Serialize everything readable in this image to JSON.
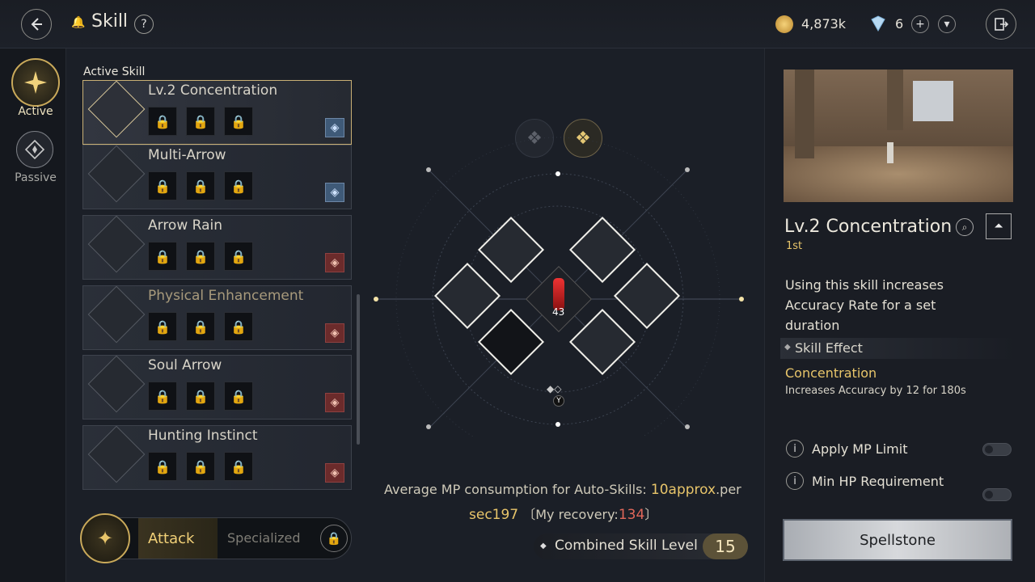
{
  "header": {
    "title": "Skill",
    "help_label": "?",
    "gold_amount": "4,873k",
    "gem_amount": "6",
    "plus_label": "+",
    "chevron_label": "▾"
  },
  "nav": {
    "active_label": "Active",
    "passive_label": "Passive"
  },
  "skill_list": {
    "heading": "Active Skill",
    "skills": [
      {
        "name": "Lv.2 Concentration",
        "badge": "blue"
      },
      {
        "name": "Multi-Arrow",
        "badge": "blue"
      },
      {
        "name": "Arrow Rain",
        "badge": "red"
      },
      {
        "name": "Physical Enhancement",
        "badge": "red"
      },
      {
        "name": "Soul Arrow",
        "badge": "red"
      },
      {
        "name": "Hunting Instinct",
        "badge": "red"
      }
    ]
  },
  "mode": {
    "attack_label": "Attack",
    "specialized_label": "Specialized"
  },
  "center": {
    "potion_count": "43",
    "button_y": "Y",
    "mp_line_prefix": "Average MP consumption for Auto-Skills:",
    "mp_value": "10approx",
    "mp_per": ".per",
    "sec_value": "sec197",
    "recovery_prefix": "〔My recovery:",
    "recovery_value": "134",
    "recovery_suffix": "〕",
    "combined_label": "Combined Skill Level",
    "combined_value": "15"
  },
  "detail": {
    "skill_name": "Lv.2 Concentration",
    "rank": "1st",
    "description_1": "Using this skill increases",
    "description_2": "Accuracy Rate for a set",
    "description_3": "duration",
    "effect_header": "Skill Effect",
    "effect_name": "Concentration",
    "effect_desc": "Increases Accuracy by 12 for 180s",
    "option_1": "Apply MP Limit",
    "option_2": "Min HP Requirement",
    "spellstone_label": "Spellstone"
  }
}
